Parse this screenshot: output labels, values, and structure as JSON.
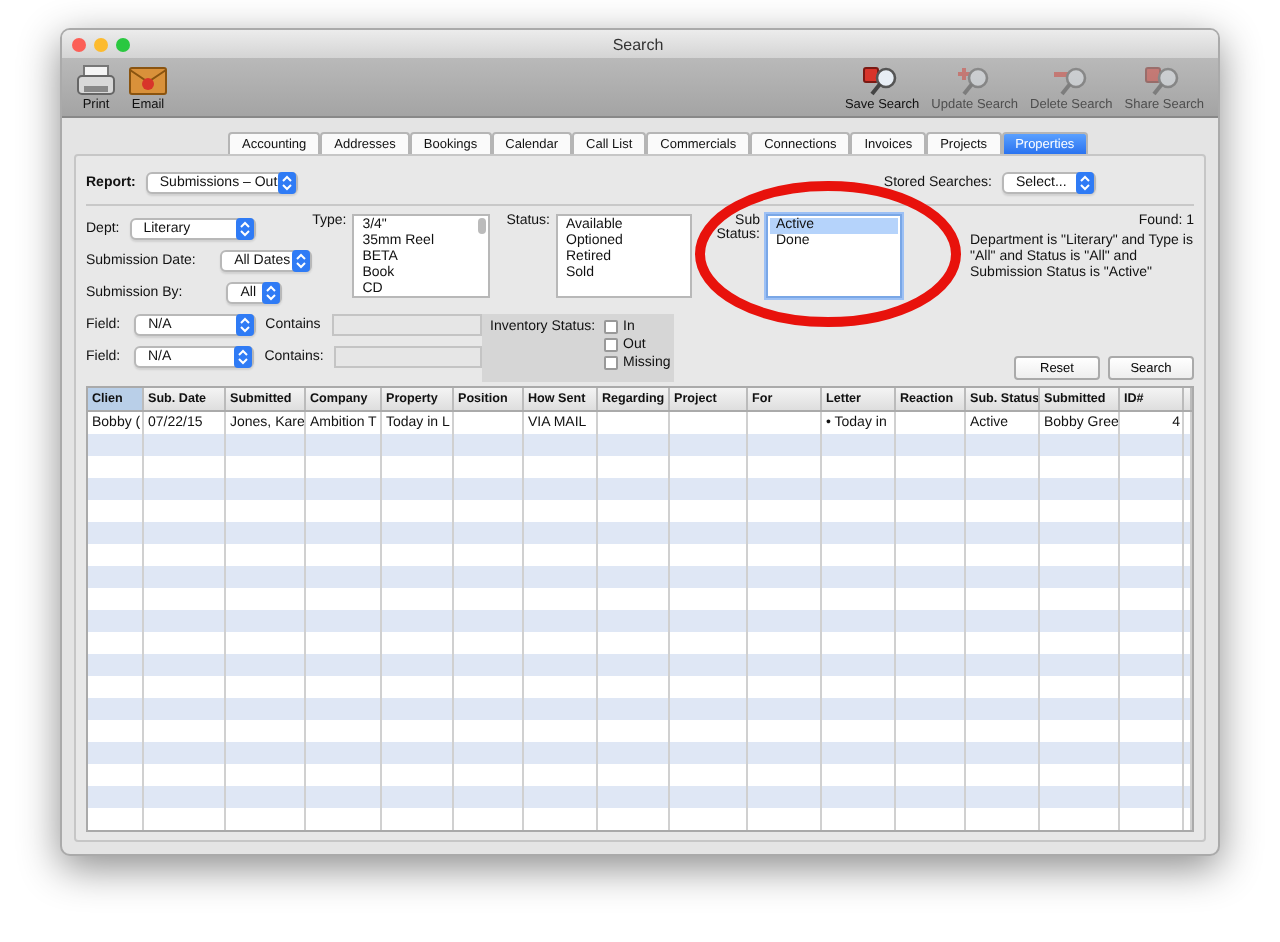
{
  "window": {
    "title": "Search"
  },
  "toolbar": {
    "left": [
      {
        "label": "Print",
        "kind": "print",
        "disabled": false
      },
      {
        "label": "Email",
        "kind": "email",
        "disabled": false
      }
    ],
    "right": [
      {
        "label": "Save Search",
        "kind": "save",
        "disabled": false
      },
      {
        "label": "Update Search",
        "kind": "update",
        "disabled": true
      },
      {
        "label": "Delete Search",
        "kind": "delete",
        "disabled": true
      },
      {
        "label": "Share Search",
        "kind": "share",
        "disabled": true
      }
    ]
  },
  "tabs": [
    {
      "label": "Accounting",
      "selected": false
    },
    {
      "label": "Addresses",
      "selected": false
    },
    {
      "label": "Bookings",
      "selected": false
    },
    {
      "label": "Calendar",
      "selected": false
    },
    {
      "label": "Call List",
      "selected": false
    },
    {
      "label": "Commercials",
      "selected": false
    },
    {
      "label": "Connections",
      "selected": false
    },
    {
      "label": "Invoices",
      "selected": false
    },
    {
      "label": "Projects",
      "selected": false
    },
    {
      "label": "Properties",
      "selected": true
    }
  ],
  "report": {
    "label": "Report:",
    "value": "Submissions – Out"
  },
  "stored_searches": {
    "label": "Stored Searches:",
    "value": "Select..."
  },
  "dept": {
    "label": "Dept:",
    "value": "Literary"
  },
  "submission_date": {
    "label": "Submission Date:",
    "value": "All Dates"
  },
  "submission_by": {
    "label": "Submission By:",
    "value": "All"
  },
  "type": {
    "label": "Type:",
    "items": [
      {
        "label": "3/4\"",
        "selected": false
      },
      {
        "label": "35mm Reel",
        "selected": false
      },
      {
        "label": "BETA",
        "selected": false
      },
      {
        "label": "Book",
        "selected": false
      },
      {
        "label": "CD",
        "selected": false
      }
    ]
  },
  "status": {
    "label": "Status:",
    "items": [
      {
        "label": "Available",
        "selected": false
      },
      {
        "label": "Optioned",
        "selected": false
      },
      {
        "label": "Retired",
        "selected": false
      },
      {
        "label": "Sold",
        "selected": false
      }
    ]
  },
  "sub_status": {
    "label": "Sub Status:",
    "items": [
      {
        "label": "Active",
        "selected": true
      },
      {
        "label": "Done",
        "selected": false
      }
    ]
  },
  "found": "Found: 1",
  "description": "Department is \"Literary\" and Type is \"All\" and Status is \"All\" and Submission Status is \"Active\"",
  "fields": [
    {
      "label": "Field:",
      "value": "N/A",
      "contains_label": "Contains"
    },
    {
      "label": "Field:",
      "value": "N/A",
      "contains_label": "Contains:"
    }
  ],
  "inventory_status": {
    "label": "Inventory Status:",
    "options": [
      {
        "label": "In",
        "checked": false
      },
      {
        "label": "Out",
        "checked": false
      },
      {
        "label": "Missing",
        "checked": false
      }
    ]
  },
  "buttons": [
    "Reset",
    "Search"
  ],
  "table": {
    "columns": [
      {
        "label": "Clien",
        "sorted": true
      },
      {
        "label": "Sub. Date",
        "sorted": false
      },
      {
        "label": "Submitted",
        "sorted": false
      },
      {
        "label": "Company",
        "sorted": false
      },
      {
        "label": "Property",
        "sorted": false
      },
      {
        "label": "Position",
        "sorted": false
      },
      {
        "label": "How Sent",
        "sorted": false
      },
      {
        "label": "Regarding",
        "sorted": false
      },
      {
        "label": "Project",
        "sorted": false
      },
      {
        "label": "For",
        "sorted": false
      },
      {
        "label": "Letter",
        "sorted": false
      },
      {
        "label": "Reaction",
        "sorted": false
      },
      {
        "label": "Sub. Status",
        "sorted": false
      },
      {
        "label": "Submitted",
        "sorted": false
      },
      {
        "label": "ID#",
        "sorted": false
      }
    ],
    "rows": [
      [
        "Bobby (",
        "07/22/15",
        "Jones, Kare",
        "Ambition T",
        "Today in L",
        "",
        "VIA MAIL",
        "",
        "",
        "",
        "• Today in",
        "",
        "Active",
        "Bobby Gree",
        "4"
      ]
    ]
  }
}
